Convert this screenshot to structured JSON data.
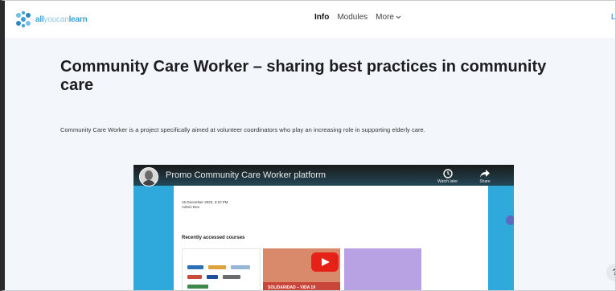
{
  "nav": {
    "logo_text_1": "all",
    "logo_text_2": "youcan",
    "logo_text_3": "learn",
    "items": [
      "Info",
      "Modules",
      "More"
    ],
    "right_link": "Lo"
  },
  "page": {
    "title": "Community Care Worker – sharing best practices in community care",
    "description": "Community Care Worker is a project specifically aimed at volunteer coordinators who play an increasing role in supporting elderly care."
  },
  "video": {
    "title": "Promo Community Care Worker platform",
    "watch_later": "Watch later",
    "share": "Share",
    "inner": {
      "date": "15 December 2023, 3:10 PM",
      "author": "Admin Dev",
      "recent_heading": "Recently accessed courses",
      "card2_text": "SOLIDARIDAD – VIDA 19"
    }
  },
  "help_label": "?",
  "colors": {
    "brand": "#3aa0d8",
    "video_bg": "#2fa9dc",
    "play": "#e62117"
  }
}
